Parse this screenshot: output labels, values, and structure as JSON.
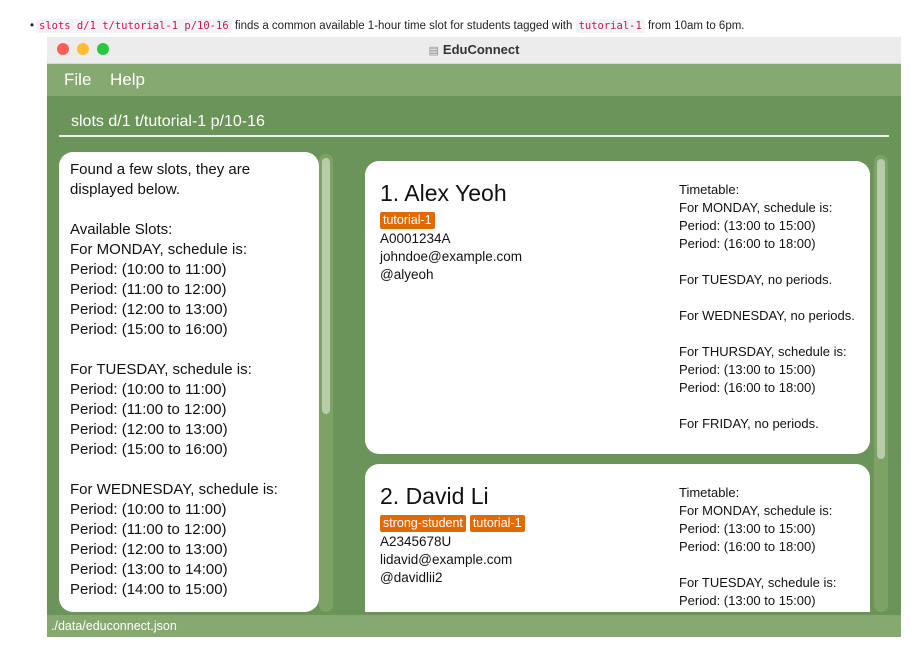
{
  "caption": {
    "command": "slots d/1 t/tutorial-1 p/10-16",
    "text_a": " finds a common available 1-hour time slot for students tagged with ",
    "tag": "tutorial-1",
    "text_b": " from 10am to 6pm."
  },
  "window": {
    "title": "EduConnect"
  },
  "menu": {
    "file": "File",
    "help": "Help"
  },
  "command_box": {
    "value": "slots d/1 t/tutorial-1 p/10-16"
  },
  "result": {
    "text": "Found a few slots, they are displayed below.\n\nAvailable Slots:\nFor MONDAY, schedule is:\nPeriod: (10:00 to 11:00)\nPeriod: (11:00 to 12:00)\nPeriod: (12:00 to 13:00)\nPeriod: (15:00 to 16:00)\n\nFor TUESDAY, schedule is:\nPeriod: (10:00 to 11:00)\nPeriod: (11:00 to 12:00)\nPeriod: (12:00 to 13:00)\nPeriod: (15:00 to 16:00)\n\nFor WEDNESDAY, schedule is:\nPeriod: (10:00 to 11:00)\nPeriod: (11:00 to 12:00)\nPeriod: (12:00 to 13:00)\nPeriod: (13:00 to 14:00)\nPeriod: (14:00 to 15:00)"
  },
  "persons": [
    {
      "index_name": "1.  Alex Yeoh",
      "tags": [
        "tutorial-1"
      ],
      "student_id": "A0001234A",
      "email": "johndoe@example.com",
      "telegram": "@alyeoh",
      "timetable": "Timetable:\nFor MONDAY, schedule is:\nPeriod: (13:00 to 15:00)\nPeriod: (16:00 to 18:00)\n\nFor TUESDAY, no periods.\n\nFor WEDNESDAY, no periods.\n\nFor THURSDAY, schedule is:\nPeriod: (13:00 to 15:00)\nPeriod: (16:00 to 18:00)\n\nFor FRIDAY, no periods."
    },
    {
      "index_name": "2.  David Li",
      "tags": [
        "strong-student",
        "tutorial-1"
      ],
      "student_id": "A2345678U",
      "email": "lidavid@example.com",
      "telegram": "@davidlii2",
      "timetable": "Timetable:\nFor MONDAY, schedule is:\nPeriod: (13:00 to 15:00)\nPeriod: (16:00 to 18:00)\n\nFor TUESDAY, schedule is:\nPeriod: (13:00 to 15:00)"
    }
  ],
  "status_bar": {
    "path": "./data/educonnect.json"
  },
  "colors": {
    "window_bg": "#6b9458",
    "menubar": "#86a970",
    "tag": "#e26a00",
    "card": "#ffffff"
  }
}
